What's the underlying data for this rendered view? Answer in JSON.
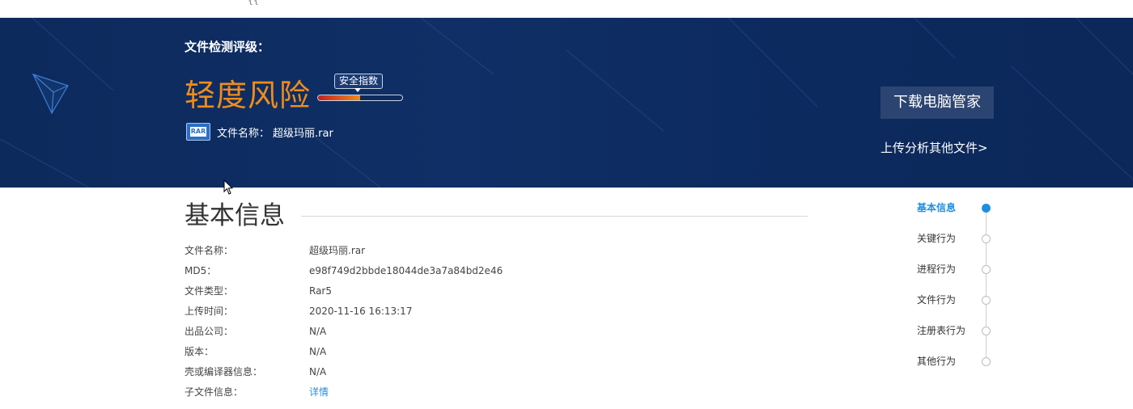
{
  "header": {
    "eyebrow": "文件检测评级：",
    "risk_level": "轻度风险",
    "gauge_label": "安全指数",
    "gauge_level_pct": 50,
    "file_label": "文件名称：",
    "file_name": "超级玛丽.rar",
    "file_icon": "rar-archive-icon",
    "download_button": "下载电脑管家",
    "upload_link": "上传分析其他文件>",
    "colors": {
      "bg": "#0d2a5c",
      "risk": "#f08c1a"
    }
  },
  "top_fragment": "{{",
  "section": {
    "title": "基本信息",
    "rows": [
      {
        "key": "文件名称：",
        "value": "超级玛丽.rar"
      },
      {
        "key": "MD5：",
        "value": "e98f749d2bbde18044de3a7a84bd2e46"
      },
      {
        "key": "文件类型：",
        "value": "Rar5"
      },
      {
        "key": "上传时间：",
        "value": "2020-11-16 16:13:17"
      },
      {
        "key": "出品公司：",
        "value": "N/A"
      },
      {
        "key": "版本：",
        "value": "N/A"
      },
      {
        "key": "壳或编译器信息：",
        "value": "N/A"
      },
      {
        "key": "子文件信息：",
        "value": "详情"
      }
    ]
  },
  "side_nav": {
    "items": [
      {
        "label": "基本信息",
        "active": true
      },
      {
        "label": "关键行为",
        "active": false
      },
      {
        "label": "进程行为",
        "active": false
      },
      {
        "label": "文件行为",
        "active": false
      },
      {
        "label": "注册表行为",
        "active": false
      },
      {
        "label": "其他行为",
        "active": false
      }
    ],
    "accent": "#1e8fe0"
  }
}
